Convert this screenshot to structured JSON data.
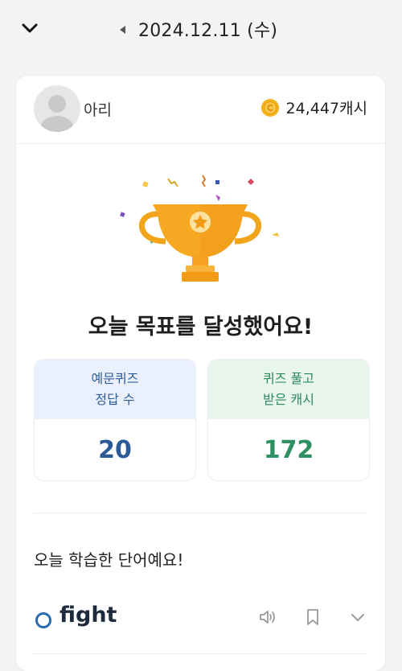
{
  "header": {
    "date": "2024.12.11 (수)"
  },
  "profile": {
    "name": "아리",
    "cash": "24,447캐시"
  },
  "goal": {
    "message": "오늘 목표를 달성했어요!"
  },
  "stats": {
    "quiz_correct": {
      "label_line1": "예문퀴즈",
      "label_line2": "정답 수",
      "value": "20"
    },
    "quiz_cash": {
      "label_line1": "퀴즈 풀고",
      "label_line2": "받은 캐시",
      "value": "172"
    }
  },
  "learned": {
    "title": "오늘 학습한 단어예요!",
    "words": [
      {
        "word": "fight"
      }
    ]
  },
  "colors": {
    "accent_blue": "#2b5a97",
    "accent_green": "#2f9161",
    "trophy_gold": "#f5a623"
  }
}
